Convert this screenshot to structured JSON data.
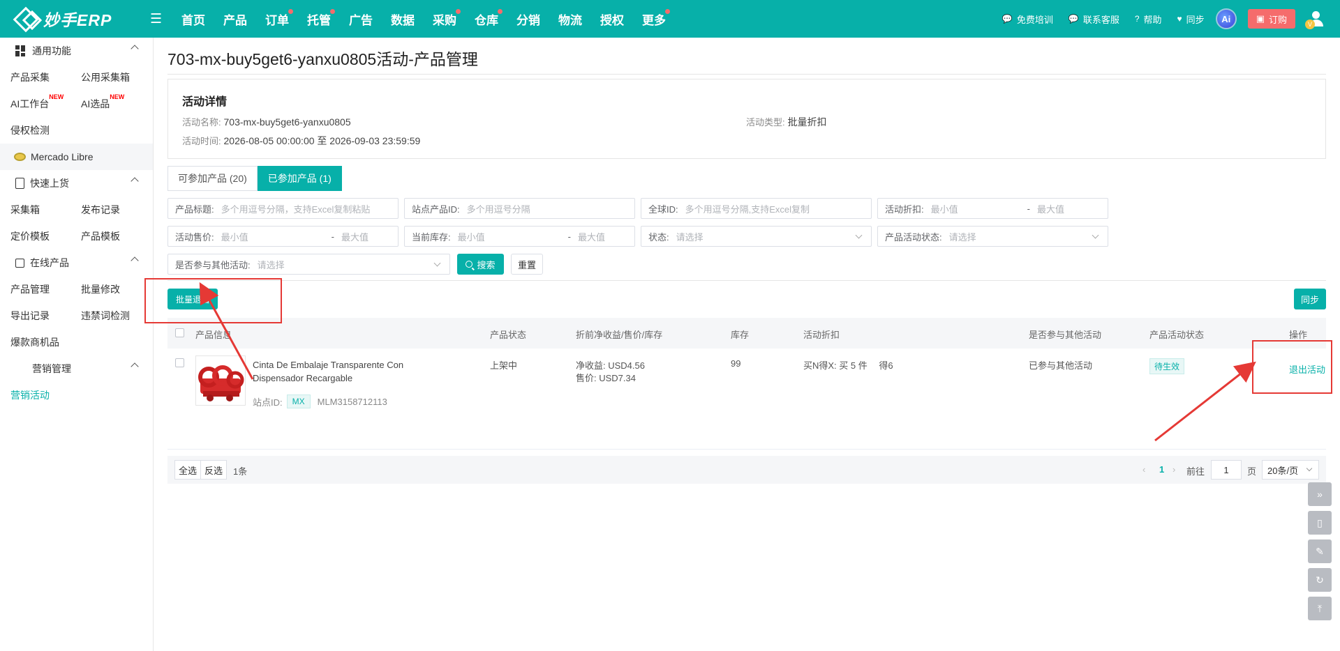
{
  "app": {
    "name": "妙手ERP"
  },
  "nav": [
    {
      "label": "首页",
      "dot": false
    },
    {
      "label": "产品",
      "dot": false
    },
    {
      "label": "订单",
      "dot": true
    },
    {
      "label": "托管",
      "dot": true
    },
    {
      "label": "广告",
      "dot": false
    },
    {
      "label": "数据",
      "dot": false
    },
    {
      "label": "采购",
      "dot": true
    },
    {
      "label": "仓库",
      "dot": true
    },
    {
      "label": "分销",
      "dot": false
    },
    {
      "label": "物流",
      "dot": false
    },
    {
      "label": "授权",
      "dot": false
    },
    {
      "label": "更多",
      "dot": true
    }
  ],
  "topright": {
    "training": "免费培训",
    "support": "联系客服",
    "help": "帮助",
    "sync": "同步",
    "ai": "Ai",
    "order": "订购",
    "avatar_badge": "V"
  },
  "sidebar": {
    "sections": [
      {
        "title": "通用功能",
        "rows": [
          [
            "产品采集",
            "公用采集箱"
          ],
          [
            "AI工作台",
            "AI选品"
          ],
          [
            "侵权检测",
            ""
          ]
        ]
      },
      {
        "title": "快速上货",
        "rows": [
          [
            "采集箱",
            "发布记录"
          ],
          [
            "定价模板",
            "产品模板"
          ]
        ]
      },
      {
        "title": "在线产品",
        "rows": [
          [
            "产品管理",
            "批量修改"
          ],
          [
            "导出记录",
            "违禁词检测"
          ],
          [
            "爆款商机品",
            ""
          ]
        ]
      },
      {
        "title": "营销管理",
        "rows": [
          [
            "营销活动",
            ""
          ]
        ]
      }
    ],
    "new_badge": "NEW",
    "platform": "Mercado Libre"
  },
  "page": {
    "title": "703-mx-buy5get6-yanxu0805活动-产品管理"
  },
  "detail": {
    "heading": "活动详情",
    "name_label": "活动名称:",
    "name_value": "703-mx-buy5get6-yanxu0805",
    "type_label": "活动类型:",
    "type_value": "批量折扣",
    "time_label": "活动时间:",
    "time_value": "2026-08-05 00:00:00 至 2026-09-03 23:59:59"
  },
  "tabs": [
    {
      "label": "可参加产品 (20)",
      "active": false
    },
    {
      "label": "已参加产品 (1)",
      "active": true
    }
  ],
  "filters": {
    "title": {
      "label": "产品标题:",
      "placeholder": "多个用逗号分隔，支持Excel复制粘贴"
    },
    "site_id": {
      "label": "站点产品ID:",
      "placeholder": "多个用逗号分隔"
    },
    "global_id": {
      "label": "全球ID:",
      "placeholder": "多个用逗号分隔,支持Excel复制"
    },
    "discount": {
      "label": "活动折扣:",
      "min": "最小值",
      "max": "最大值"
    },
    "price": {
      "label": "活动售价:",
      "min": "最小值",
      "max": "最大值"
    },
    "stock": {
      "label": "当前库存:",
      "min": "最小值",
      "max": "最大值"
    },
    "status": {
      "label": "状态:",
      "placeholder": "请选择"
    },
    "act_status": {
      "label": "产品活动状态:",
      "placeholder": "请选择"
    },
    "other": {
      "label": "是否参与其他活动:",
      "placeholder": "请选择"
    },
    "dash": "-"
  },
  "buttons": {
    "search": "搜索",
    "reset": "重置",
    "batch_exit": "批量退出",
    "sync": "同步"
  },
  "table": {
    "headers": [
      "产品信息",
      "产品状态",
      "折前净收益/售价/库存",
      "库存",
      "活动折扣",
      "是否参与其他活动",
      "产品活动状态",
      "操作"
    ],
    "rows": [
      {
        "title": "Cinta De Embalaje Transparente Con Dispensador Recargable",
        "site_label": "站点ID:",
        "site": "MX",
        "item_id": "MLM3158712113",
        "status": "上架中",
        "net": "净收益: USD4.56",
        "price": "售价: USD7.34",
        "stock": "99",
        "discount": "买N得X: 买 5 件 　得6",
        "other": "已参与其他活动",
        "act_status": "待生效",
        "action": "退出活动"
      }
    ]
  },
  "pager": {
    "select_all": "全选",
    "invert": "反选",
    "count": "1条",
    "current_page": "1",
    "goto_label": "前往",
    "goto_value": "1",
    "page_unit": "页",
    "page_size": "20条/页"
  },
  "colors": {
    "brand": "#07b0a9",
    "danger": "#e53935",
    "order": "#f56c6c"
  }
}
